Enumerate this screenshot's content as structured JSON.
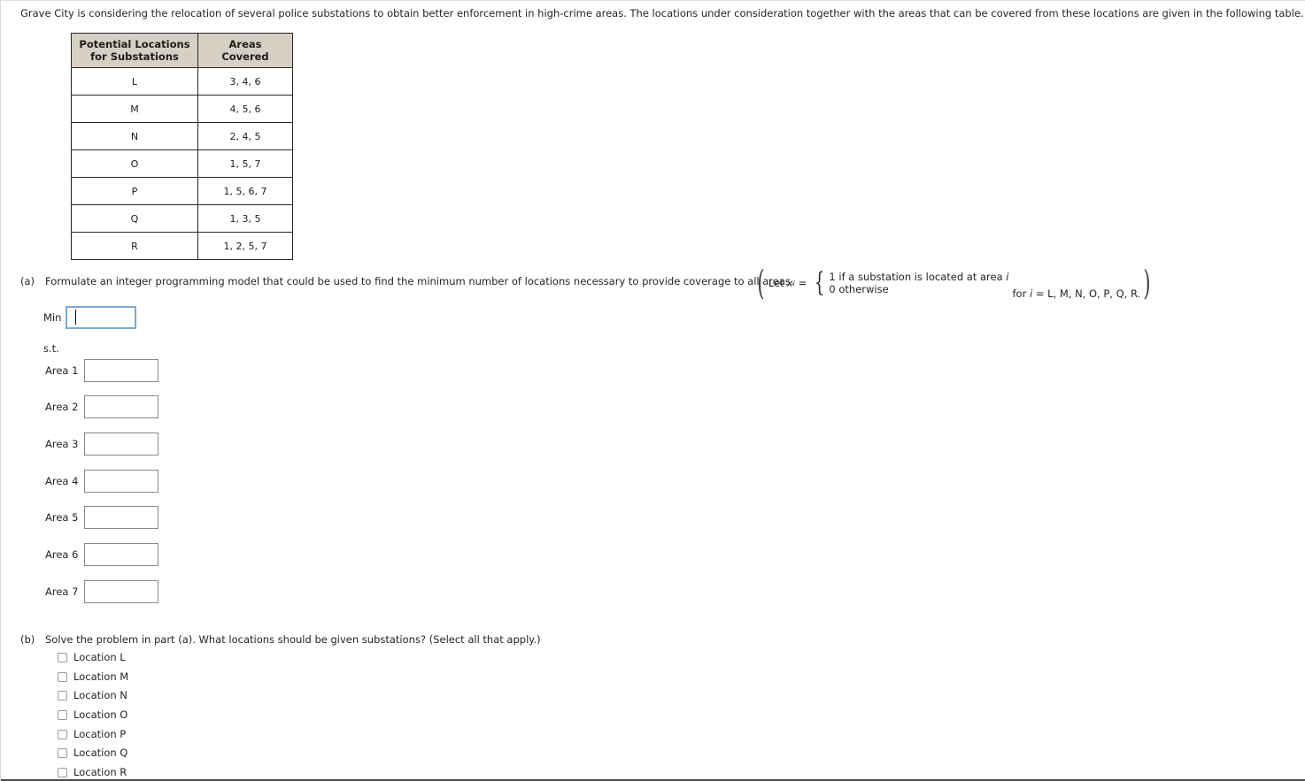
{
  "intro": "Grave City is considering the relocation of several police substations to obtain better enforcement in high-crime areas. The locations under consideration together with the areas that can be covered from these locations are given in the following table.",
  "table": {
    "headers": [
      "Potential Locations for Substations",
      "Areas Covered"
    ],
    "header_line1": "Potential Locations",
    "header_line2": "for Substations",
    "header2": "Areas Covered",
    "rows": [
      {
        "location": "L",
        "areas": "3, 4, 6"
      },
      {
        "location": "M",
        "areas": "4, 5, 6"
      },
      {
        "location": "N",
        "areas": "2, 4, 5"
      },
      {
        "location": "O",
        "areas": "1, 5, 7"
      },
      {
        "location": "P",
        "areas": "1, 5, 6, 7"
      },
      {
        "location": "Q",
        "areas": "1, 3, 5"
      },
      {
        "location": "R",
        "areas": "1, 2, 5, 7"
      }
    ]
  },
  "part_a": {
    "marker": "(a)",
    "text": "Formulate an integer programming model that could be used to find the minimum number of locations necessary to provide coverage to all areas.",
    "definition": {
      "let": "Let",
      "variable": "x",
      "subscript": "i",
      "equals": "=",
      "case1": "1 if a substation is located at area i",
      "case1_prefix": "1 if a substation is located at area",
      "case1_italic": "i",
      "case2": "0 otherwise",
      "for_prefix": "for",
      "for_italic": "i",
      "for_suffix": "= L, M, N, O, P, Q, R."
    },
    "min_label": "Min",
    "min_value": "",
    "min_focused": true,
    "st_label": "s.t.",
    "constraints": [
      {
        "label": "Area 1",
        "value": ""
      },
      {
        "label": "Area 2",
        "value": ""
      },
      {
        "label": "Area 3",
        "value": ""
      },
      {
        "label": "Area 4",
        "value": ""
      },
      {
        "label": "Area 5",
        "value": ""
      },
      {
        "label": "Area 6",
        "value": ""
      },
      {
        "label": "Area 7",
        "value": ""
      }
    ]
  },
  "part_b": {
    "marker": "(b)",
    "text": "Solve the problem in part (a). What locations should be given substations? (Select all that apply.)",
    "options": [
      {
        "label": "Location L",
        "checked": false
      },
      {
        "label": "Location M",
        "checked": false
      },
      {
        "label": "Location N",
        "checked": false
      },
      {
        "label": "Location O",
        "checked": false
      },
      {
        "label": "Location P",
        "checked": false
      },
      {
        "label": "Location Q",
        "checked": false
      },
      {
        "label": "Location R",
        "checked": false
      }
    ]
  },
  "colors": {
    "header_bg": "#d5d0c3",
    "table_border": "#262626",
    "focus_border": "#7da9d3",
    "input_border": "#888888",
    "text": "#242424"
  }
}
